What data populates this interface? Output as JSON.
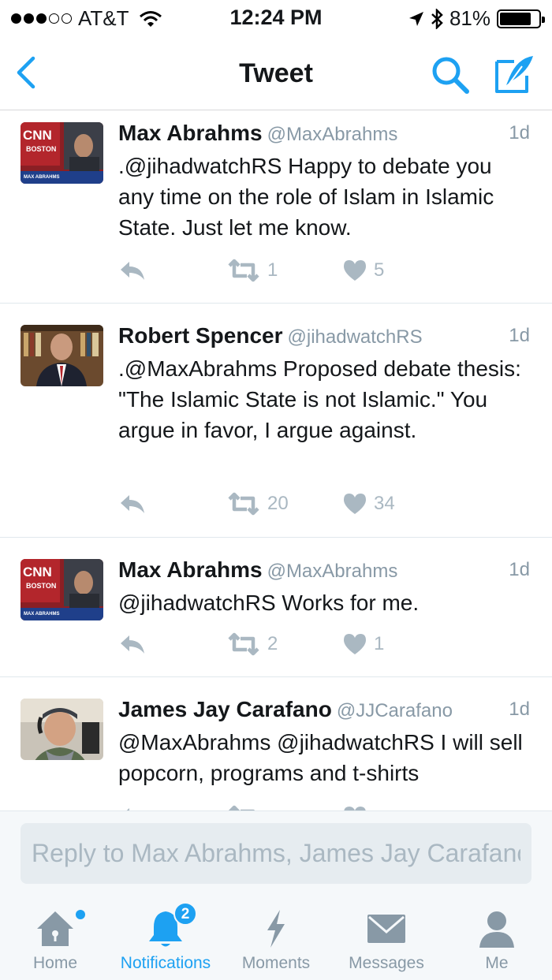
{
  "status_bar": {
    "carrier": "AT&T",
    "time": "12:24 PM",
    "battery": "81%",
    "battery_level": 0.81
  },
  "nav": {
    "title": "Tweet"
  },
  "tweets": [
    {
      "name": "Max Abrahms",
      "handle": "@MaxAbrahms",
      "time": "1d",
      "text": ".@jihadwatchRS Happy to debate you any time on the role of Islam in Islamic State. Just let me know.",
      "retweets": "1",
      "likes": "5",
      "avatar_caption": "MAX ABRAHMS",
      "avatar_logo": "CNN",
      "avatar_subtext": "BOSTON"
    },
    {
      "name": "Robert Spencer",
      "handle": "@jihadwatchRS",
      "time": "1d",
      "text": ".@MaxAbrahms Proposed debate thesis: \"The Islamic State is not Islamic.\" You argue in favor, I argue against.",
      "retweets": "20",
      "likes": "34"
    },
    {
      "name": "Max Abrahms",
      "handle": "@MaxAbrahms",
      "time": "1d",
      "text": "@jihadwatchRS Works for me.",
      "retweets": "2",
      "likes": "1",
      "avatar_caption": "MAX ABRAHMS",
      "avatar_logo": "CNN",
      "avatar_subtext": "BOSTON"
    },
    {
      "name": "James Jay Carafano",
      "handle": "@JJCarafano",
      "time": "1d",
      "text": "@MaxAbrahms @jihadwatchRS I will sell popcorn, programs and t-shirts"
    }
  ],
  "reply": {
    "placeholder": "Reply to Max Abrahms, James Jay Carafano"
  },
  "tabs": [
    {
      "label": "Home",
      "icon": "home-icon"
    },
    {
      "label": "Notifications",
      "icon": "bell-icon",
      "badge": "2"
    },
    {
      "label": "Moments",
      "icon": "lightning-icon"
    },
    {
      "label": "Messages",
      "icon": "envelope-icon"
    },
    {
      "label": "Me",
      "icon": "person-icon"
    }
  ],
  "colors": {
    "accent": "#1da1f2",
    "icon_gray": "#aab8c2",
    "secondary_text": "#8899a6"
  }
}
